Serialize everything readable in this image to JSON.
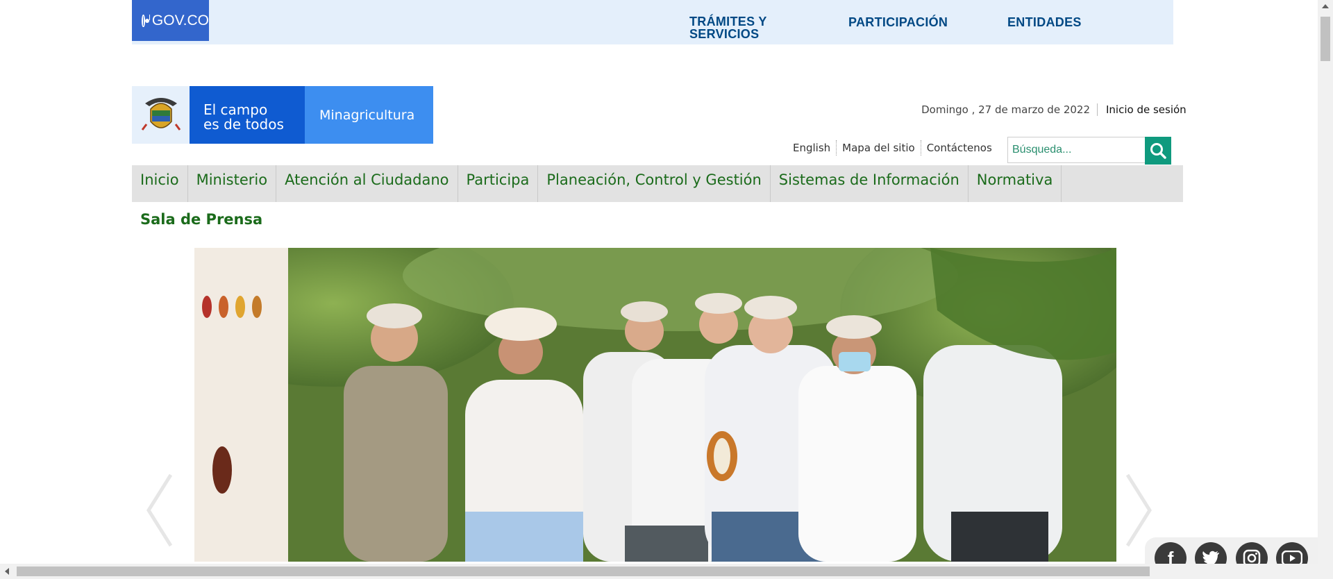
{
  "govbar": {
    "logo_text": "GOV.CO",
    "nav": [
      "TRÁMITES Y SERVICIOS",
      "PARTICIPACIÓN",
      "ENTIDADES"
    ]
  },
  "header": {
    "brand_line1": "El campo",
    "brand_line2": "es de todos",
    "ministry": "Minagricultura",
    "date": "Domingo , 27 de marzo de 2022",
    "login": "Inicio de sesión",
    "util_links": [
      "English",
      "Mapa del sitio",
      "Contáctenos"
    ],
    "search_placeholder": "Búsqueda..."
  },
  "main_nav": [
    "Inicio",
    "Ministerio",
    "Atención al Ciudadano",
    "Participa",
    "Planeación, Control y Gestión",
    "Sistemas de Información",
    "Normativa"
  ],
  "section_title": "Sala de Prensa",
  "social": [
    "facebook-icon",
    "twitter-icon",
    "instagram-icon",
    "youtube-icon"
  ],
  "colors": {
    "gov_blue": "#3366cc",
    "gov_nav_text": "#004884",
    "nav_green": "#1b6b1b",
    "search_button": "#0f9a7e",
    "brand_blue": "#0f5bd1",
    "brand_light_blue": "#3d8ef0"
  }
}
